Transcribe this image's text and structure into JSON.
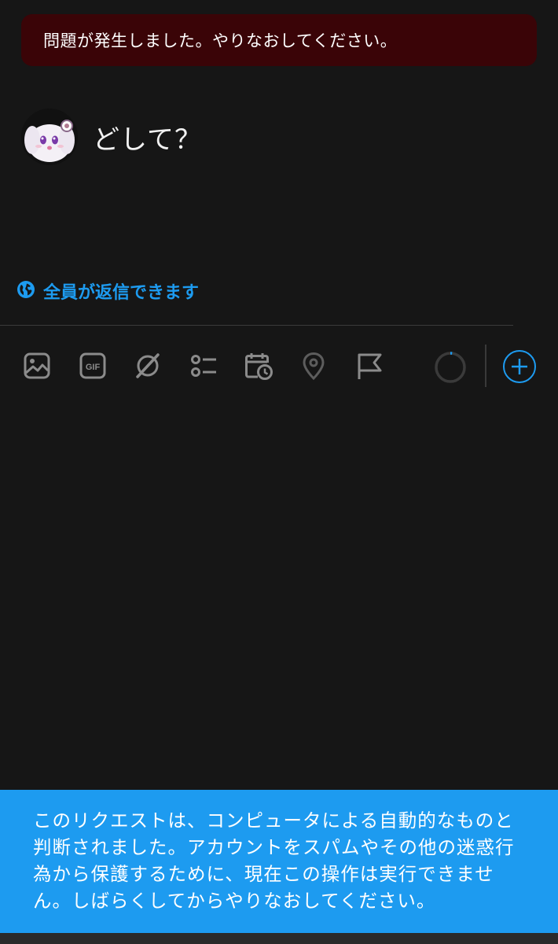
{
  "error_banner": {
    "text": "問題が発生しました。やりなおしてください。"
  },
  "composer": {
    "text": "どして？"
  },
  "reply_setting": {
    "label": "全員が返信できます",
    "icon": "globe-icon"
  },
  "toolbar": {
    "icons": [
      "image-icon",
      "gif-icon",
      "grok-icon",
      "poll-icon",
      "schedule-icon",
      "location-icon",
      "flag-icon"
    ],
    "gif_label": "GIF",
    "character_counter_progress": 0.02,
    "add_icon": "plus-icon"
  },
  "toast": {
    "text": "このリクエストは、コンピュータによる自動的なものと判断されました。アカウントをスパムやその他の迷惑行為から保護するために、現在この操作は実行できません。しばらくしてからやりなおしてください。"
  },
  "colors": {
    "accent": "#1d9bf0",
    "background": "#161616",
    "error_banner": "#3a0407",
    "icon": "#8b8b8b"
  }
}
